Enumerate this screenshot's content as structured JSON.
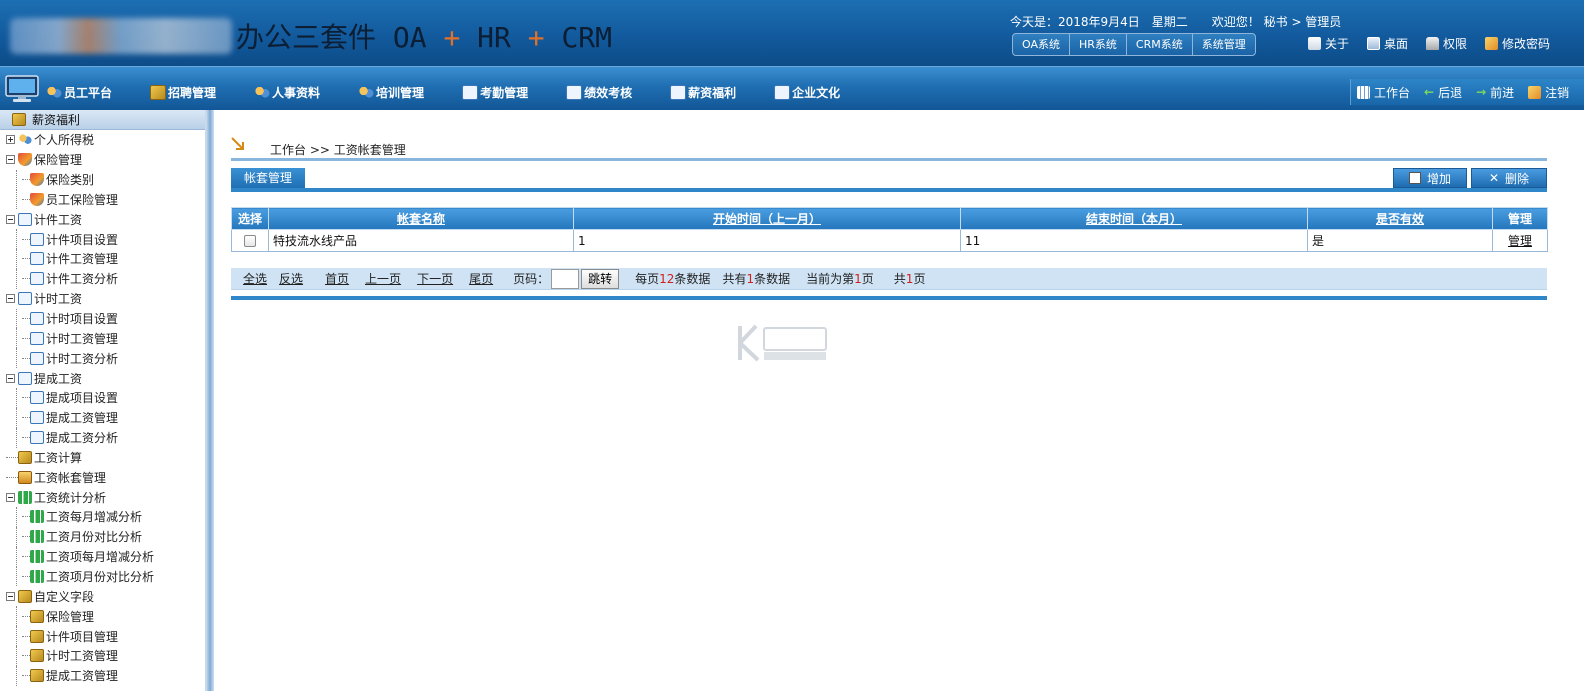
{
  "header": {
    "app_title_prefix": "办公三套件 OA ",
    "plus1": "+",
    "hr": " HR ",
    "plus2": "+",
    "crm": " CRM",
    "date_line": "今天是：2018年9月4日　星期二　　欢迎您！ 秘书 > 管理员",
    "sys_tabs": [
      "OA系统",
      "HR系统",
      "CRM系统",
      "系统管理"
    ],
    "top_links": [
      "关于",
      "桌面",
      "权限",
      "修改密码"
    ]
  },
  "nav": {
    "items": [
      "员工平台",
      "招聘管理",
      "人事资料",
      "培训管理",
      "考勤管理",
      "绩效考核",
      "薪资福利",
      "企业文化"
    ],
    "right": [
      "工作台",
      "后退",
      "前进",
      "注销"
    ]
  },
  "sidebar": {
    "title": "薪资福利",
    "items": [
      "个人所得税",
      "保险管理",
      "保险类别",
      "员工保险管理",
      "计件工资",
      "计件项目设置",
      "计件工资管理",
      "计件工资分析",
      "计时工资",
      "计时项目设置",
      "计时工资管理",
      "计时工资分析",
      "提成工资",
      "提成项目设置",
      "提成工资管理",
      "提成工资分析",
      "工资计算",
      "工资帐套管理",
      "工资统计分析",
      "工资每月增减分析",
      "工资月份对比分析",
      "工资项每月增减分析",
      "工资项月份对比分析",
      "自定义字段",
      "保险管理",
      "计件项目管理",
      "计时工资管理",
      "提成工资管理"
    ]
  },
  "main": {
    "breadcrumb": "工作台 >> 工资帐套管理",
    "section_tab": "帐套管理",
    "add_label": "增加",
    "delete_label": "删除",
    "table": {
      "headers": [
        "选择",
        "帐套名称",
        "开始时间（上一月）",
        "结束时间（本月）",
        "是否有效",
        "管理"
      ],
      "rows": [
        {
          "name": "特技流水线产品",
          "start": "1",
          "end": "11",
          "valid": "是",
          "action": "管理"
        }
      ]
    },
    "pager": {
      "select_all": "全选",
      "invert": "反选",
      "first": "首页",
      "prev": "上一页",
      "next": "下一页",
      "last": "尾页",
      "page_label": "页码：",
      "jump": "跳转",
      "per_page_pre": "每页",
      "per_page": "12",
      "per_page_post": "条数据",
      "total_pre": "共有",
      "total": "1",
      "total_post": "条数据",
      "current_pre": "当前为第",
      "current": "1",
      "current_post": "页",
      "pages_pre": "共",
      "pages": "1",
      "pages_post": "页"
    }
  },
  "colors": {
    "header_blue": "#125a9d",
    "accent_orange": "#e0702a",
    "table_header": "#2576bd",
    "red": "#d0201a"
  }
}
